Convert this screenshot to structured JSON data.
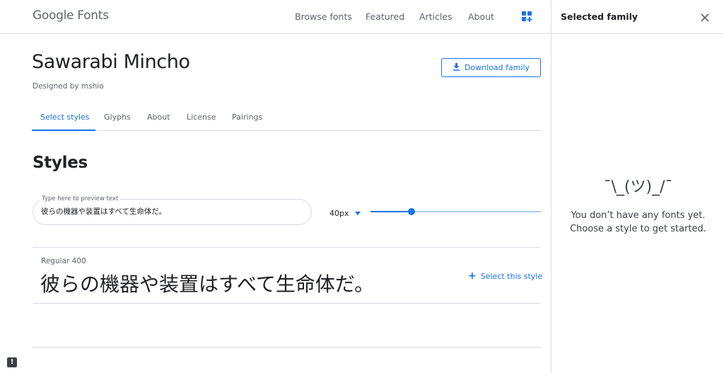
{
  "header": {
    "logo": "Google Fonts",
    "nav": {
      "browse": "Browse fonts",
      "featured": "Featured",
      "articles": "Articles",
      "about": "About"
    }
  },
  "panel": {
    "title": "Selected family",
    "shrug": "¯\\_(ツ)_/¯",
    "empty_line1": "You don’t have any fonts yet.",
    "empty_line2": "Choose a style to get started."
  },
  "family": {
    "name": "Sawarabi Mincho",
    "designer": "Designed by mshio",
    "download_label": "Download family"
  },
  "tabs": [
    {
      "label": "Select styles"
    },
    {
      "label": "Glyphs"
    },
    {
      "label": "About"
    },
    {
      "label": "License"
    },
    {
      "label": "Pairings"
    }
  ],
  "styles": {
    "heading": "Styles",
    "preview_label": "Type here to preview text",
    "preview_value": "彼らの機器や装置はすべて生命体だ。",
    "size_value": "40px",
    "size_slider_fraction": 0.12,
    "items": [
      {
        "name": "Regular 400",
        "sample": "彼らの機器や装置はすべて生命体だ。",
        "select_label": "Select this style"
      }
    ]
  },
  "colors": {
    "accent": "#1a73e8",
    "text": "#202124",
    "muted": "#5f6368",
    "border": "#dadce0"
  },
  "icons": {
    "grid": "apps-add-icon",
    "close": "close-icon",
    "download": "download-icon",
    "feedback": "feedback-icon"
  }
}
